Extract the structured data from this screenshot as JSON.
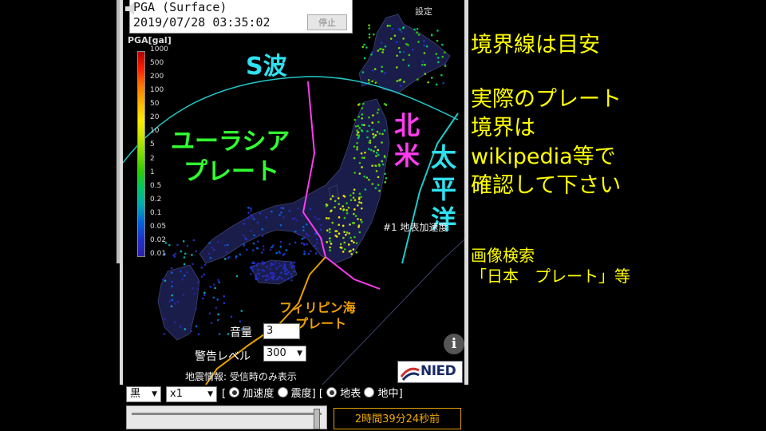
{
  "header": {
    "title": "PGA (Surface)",
    "datetime": "2019/07/28 03:35:02",
    "stop_label": "停止"
  },
  "settings_label": "設定",
  "scale": {
    "title": "PGA[gal]",
    "ticks": [
      "1000",
      "500",
      "200",
      "100",
      "50",
      "20",
      "10",
      "5",
      "2",
      "1",
      "0.5",
      "0.2",
      "0.1",
      "0.05",
      "0.02",
      "0.01"
    ],
    "colors": [
      "#b40000",
      "#ff1e00",
      "#ff7800",
      "#ffb400",
      "#ffeb00",
      "#c8e600",
      "#7adc00",
      "#2ecc00",
      "#00c864",
      "#00aab4",
      "#0064dc",
      "#1e32c8",
      "#2b22a8"
    ]
  },
  "annotations": {
    "s_wave": "S波",
    "eurasia_line1": "ユーラシア",
    "eurasia_line2": "プレート",
    "north_america_1": "北",
    "north_america_2": "米",
    "pacific_1": "太",
    "pacific_2": "平",
    "pacific_3": "洋",
    "philippine_line1": "フィリピン海",
    "philippine_line2": "プレート"
  },
  "station_label": "#1 地表加速度",
  "volume": {
    "label": "音量",
    "value": "3"
  },
  "alert": {
    "label": "警告レベル",
    "value": "300"
  },
  "quake_info": "地震情報: 受信時のみ表示",
  "logo_text": "NIED",
  "controls": {
    "bg_color": "黒",
    "speed": "x1",
    "mode_open": "[",
    "mode_accel": "加速度",
    "mode_intensity": "震度",
    "mode_close": "]",
    "loc_open": "[",
    "loc_surface": "地表",
    "loc_underground": "地中",
    "loc_close": "]",
    "elapsed": "2時間39分24秒前"
  },
  "overlay": {
    "line1": "境界線は目安",
    "line2": "実際のプレート",
    "line3": "境界は",
    "line4": "wikipedia等で",
    "line5": "確認して下さい",
    "line6": "画像検索",
    "line7": "「日本　プレート」等"
  }
}
